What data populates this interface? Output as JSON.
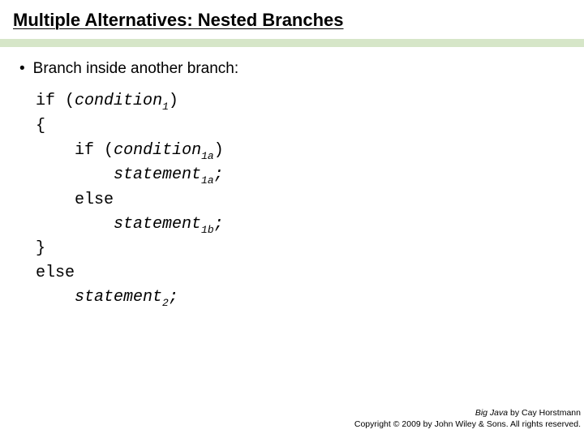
{
  "title": "Multiple Alternatives: Nested Branches",
  "bullet": "Branch inside another branch:",
  "code": {
    "kw_if": "if",
    "kw_else": "else",
    "lparen": "(",
    "rparen": ")",
    "lbrace": "{",
    "rbrace": "}",
    "semi": ";",
    "cond_word": "condition",
    "stmt_word": "statement",
    "sub1": "1",
    "sub1a": "1a",
    "sub1b": "1b",
    "sub2": "2"
  },
  "footer": {
    "book": "Big Java",
    "byline": " by Cay Horstmann",
    "copyright": "Copyright © 2009 by John Wiley & Sons.  All rights reserved."
  }
}
